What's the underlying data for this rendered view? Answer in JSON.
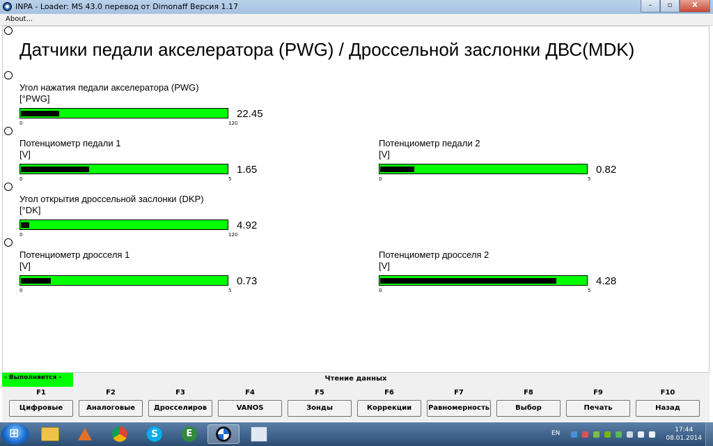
{
  "window": {
    "title": "INPA - Loader:  MS 43.0 перевод от Dimonaff Версия 1.17",
    "controls": [
      "–",
      "▫",
      "X"
    ]
  },
  "menu": {
    "about": "About..."
  },
  "page": {
    "title": "Датчики педали акселератора (PWG)  /  Дроссельной заслонки ДВС(MDK)"
  },
  "meters": [
    {
      "label": "Угол нажатия педали акселератора (PWG)",
      "unit": "[°PWG]",
      "value": "22.45",
      "min": "0",
      "max": "120",
      "fill_fraction": 0.187
    },
    {
      "label": "Потенциометр педали 1",
      "unit": "[V]",
      "value": "1.65",
      "min": "0",
      "max": "5",
      "fill_fraction": 0.33
    },
    {
      "label": "Потенциометр педали 2",
      "unit": "[V]",
      "value": "0.82",
      "min": "0",
      "max": "5",
      "fill_fraction": 0.164
    },
    {
      "label": "Угол открытия дроссельной заслонки (DKP)",
      "unit": "[°DK]",
      "value": "4.92",
      "min": "0",
      "max": "120",
      "fill_fraction": 0.041
    },
    {
      "label": "Потенциометр дросселя 1",
      "unit": "[V]",
      "value": "0.73",
      "min": "0",
      "max": "5",
      "fill_fraction": 0.146
    },
    {
      "label": "Потенциометр дросселя 2",
      "unit": "[V]",
      "value": "4.28",
      "min": "0",
      "max": "5",
      "fill_fraction": 0.856
    }
  ],
  "status": {
    "running": "- Выполняется -",
    "center": "Чтение данных"
  },
  "fkeys": [
    {
      "key": "F1",
      "label": "Цифровые"
    },
    {
      "key": "F2",
      "label": "Аналоговые"
    },
    {
      "key": "F3",
      "label": "Дросселиров"
    },
    {
      "key": "F4",
      "label": "VANOS"
    },
    {
      "key": "F5",
      "label": "Зонды"
    },
    {
      "key": "F6",
      "label": "Коррекции"
    },
    {
      "key": "F7",
      "label": "Равномерность"
    },
    {
      "key": "F8",
      "label": "Выбор"
    },
    {
      "key": "F9",
      "label": "Печать"
    },
    {
      "key": "F10",
      "label": "Назад"
    }
  ],
  "taskbar": {
    "apps": [
      "file-explorer-icon",
      "matlab-icon",
      "chrome-icon",
      "skype-icon",
      "e-app-icon",
      "bmw-inpa-icon",
      "paint-icon"
    ],
    "lang": "EN",
    "time": "17:44",
    "date": "08.01.2014"
  },
  "colors": {
    "bar": "#00ff00",
    "fill": "#000000",
    "running": "#00ff00"
  }
}
